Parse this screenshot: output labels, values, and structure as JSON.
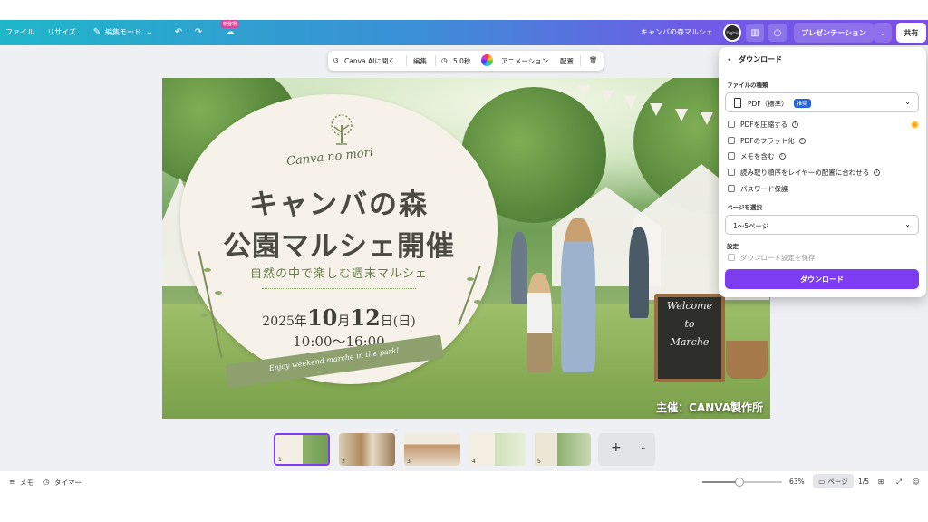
{
  "topbar": {
    "file": "ファイル",
    "resize": "リサイズ",
    "edit_mode": "編集モード",
    "new_badge": "新登場",
    "doc_title": "キャンバの森マルシェ",
    "avatar_text": "Digital",
    "present": "プレゼンテーション",
    "share": "共有"
  },
  "context_toolbar": {
    "canva_ai": "Canva AIに聞く",
    "edit": "編集",
    "duration": "5.0秒",
    "animation": "アニメーション",
    "arrange": "配置"
  },
  "design": {
    "script_title": "Canva no mori",
    "title_line1": "キャンバの森",
    "title_line2": "公園マルシェ開催",
    "subtitle": "自然の中で楽しむ週末マルシェ",
    "date_year": "2025年",
    "date_month": "10",
    "date_month_unit": "月",
    "date_day": "12",
    "date_day_unit": "日",
    "date_weekday": "(日)",
    "time": "10:00〜16:00",
    "ribbon_text": "Enjoy weekend marche in the park!",
    "board_line1": "Welcome",
    "board_line2": "to",
    "board_line3": "Marche",
    "organizer": "主催：CANVA製作所"
  },
  "download_panel": {
    "header": "ダウンロード",
    "file_type_label": "ファイルの種類",
    "file_type_value": "PDF（標準）",
    "recommended_badge": "推奨",
    "options": [
      "PDFを圧縮する",
      "PDFのフラット化",
      "メモを含む",
      "読み取り順序をレイヤーの配置に合わせる",
      "パスワード保護"
    ],
    "page_select_label": "ページを選択",
    "page_select_value": "1〜5ページ",
    "settings_label": "設定",
    "save_settings": "ダウンロード設定を保存",
    "download_button": "ダウンロード"
  },
  "thumbnails": [
    "1",
    "2",
    "3",
    "4",
    "5"
  ],
  "bottombar": {
    "memo": "メモ",
    "timer": "タイマー",
    "zoom": "63%",
    "zoom_fraction": 0.47,
    "page_view": "ページ",
    "page_count": "1/5"
  }
}
